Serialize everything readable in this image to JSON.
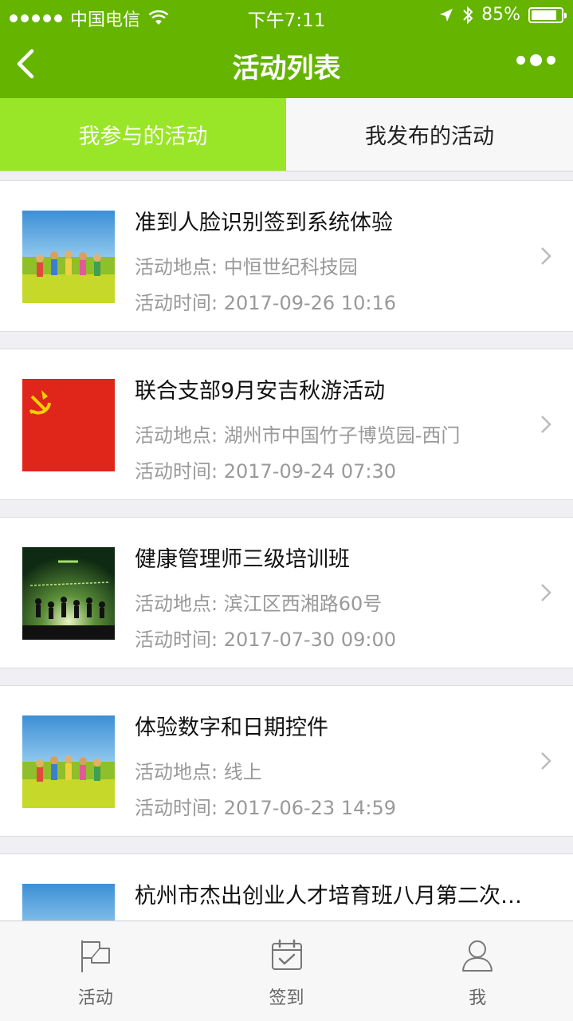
{
  "status_bar": {
    "carrier": "中国电信",
    "time": "下午7:11",
    "battery": "85%",
    "battery_level": 0.85
  },
  "nav": {
    "title": "活动列表"
  },
  "tabs": [
    {
      "label": "我参与的活动",
      "active": true
    },
    {
      "label": "我发布的活动",
      "active": false
    }
  ],
  "activities": [
    {
      "title": "准到人脸识别签到系统体验",
      "location": "活动地点: 中恒世纪科技园",
      "time": "活动时间: 2017-09-26 10:16",
      "image": "kids-field-photo"
    },
    {
      "title": "联合支部9月安吉秋游活动",
      "location": "活动地点: 湖州市中国竹子博览园-西门",
      "time": "活动时间: 2017-09-24 07:30",
      "image": "party-flag"
    },
    {
      "title": "健康管理师三级培训班",
      "location": "活动地点: 滨江区西湘路60号",
      "time": "活动时间: 2017-07-30 09:00",
      "image": "youth-silhouette-photo"
    },
    {
      "title": "体验数字和日期控件",
      "location": "活动地点: 线上",
      "time": "活动时间: 2017-06-23 14:59",
      "image": "kids-field-photo"
    },
    {
      "title": "杭州市杰出创业人才培育班八月第二次…",
      "location": "",
      "time": "",
      "image": "kids-field-photo"
    }
  ],
  "tabbar": [
    {
      "label": "活动",
      "icon": "flag-icon"
    },
    {
      "label": "签到",
      "icon": "calendar-check-icon"
    },
    {
      "label": "我",
      "icon": "user-icon"
    }
  ]
}
